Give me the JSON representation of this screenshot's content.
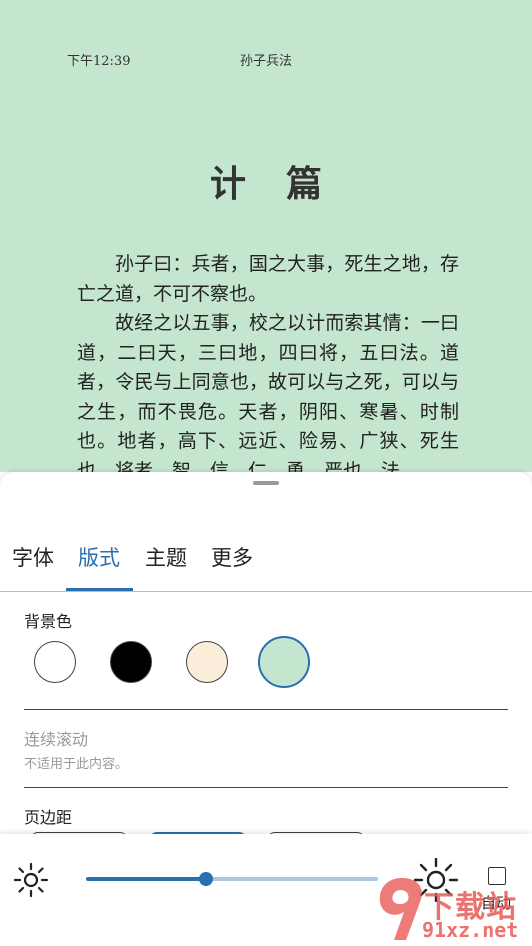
{
  "reader": {
    "time": "下午12:39",
    "book_title": "孙子兵法",
    "chapter_title": "计篇",
    "paragraphs": [
      "孙子曰：兵者，国之大事，死生之地，存亡之道，不可不察也。",
      "故经之以五事，校之以计而索其情：一曰道，二曰天，三曰地，四曰将，五曰法。道者，令民与上同意也，故可以与之死，可以与之生，而不畏危。天者，阴阳、寒暑、时制也。地者，高下、远近、险易、广狭、死生也。将者，智、信、仁、勇、严也。法"
    ],
    "background_color": "#c5e6ce"
  },
  "tabs": [
    {
      "label": "字体"
    },
    {
      "label": "版式"
    },
    {
      "label": "主题"
    },
    {
      "label": "更多"
    }
  ],
  "active_tab": 1,
  "accent_color": "#2a6fb0",
  "layout": {
    "background_label": "背景色",
    "background_options": [
      "#ffffff",
      "#000000",
      "#faeedb",
      "#c5e6ce"
    ],
    "selected_background": 3,
    "continuous_scroll_label": "连续滚动",
    "continuous_scroll_note": "不适用于此内容。",
    "margin_label": "页边距",
    "margin_selected": 1
  },
  "brightness": {
    "level_percent": 41,
    "auto_label": "自动",
    "auto_checked": false
  },
  "watermark": {
    "text_cn": "下载站",
    "url": "91xz.net"
  }
}
